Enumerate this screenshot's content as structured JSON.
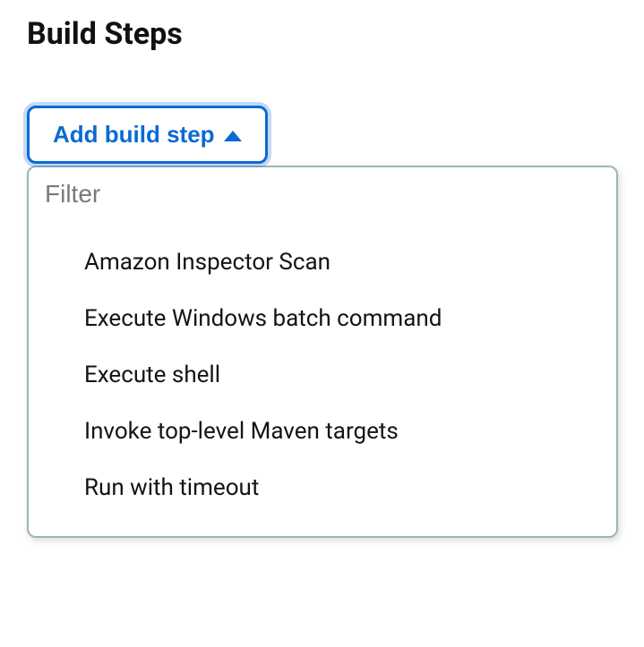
{
  "section": {
    "title": "Build Steps"
  },
  "addButton": {
    "label": "Add build step"
  },
  "filter": {
    "placeholder": "Filter",
    "value": ""
  },
  "options": [
    {
      "label": "Amazon Inspector Scan"
    },
    {
      "label": "Execute Windows batch command"
    },
    {
      "label": "Execute shell"
    },
    {
      "label": "Invoke top-level Maven targets"
    },
    {
      "label": "Run with timeout"
    }
  ]
}
